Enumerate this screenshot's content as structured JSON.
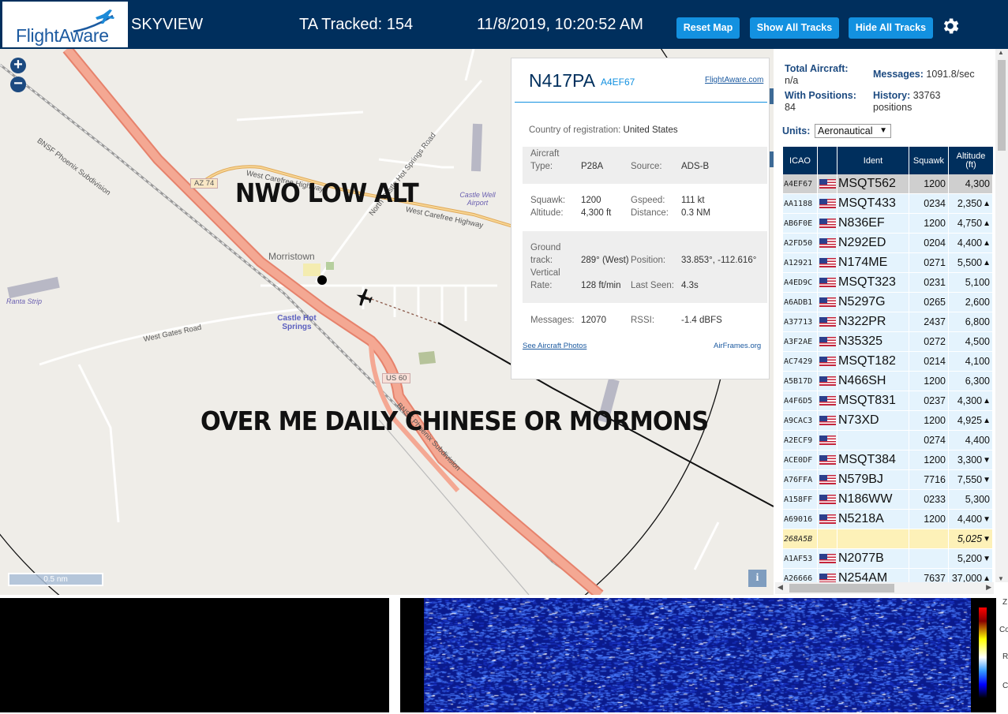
{
  "header": {
    "logo_text": "FlightAware",
    "app_name": "SKYVIEW",
    "tracked": "TA Tracked: 154",
    "datetime": "11/8/2019, 10:20:52 AM",
    "buttons": {
      "reset": "Reset Map",
      "show": "Show All Tracks",
      "hide": "Hide All Tracks"
    },
    "gear_icon": "gear-icon"
  },
  "map": {
    "zoom_in": "+",
    "zoom_out": "−",
    "labels": {
      "bnsf1": "BNSF Phoenix Subdivision",
      "bnsf2": "BNSF Phoenix Subdivision",
      "az74": "AZ 74",
      "carefree1": "West Carefree Highway",
      "carefree2": "West Carefree Highway",
      "castle_hot_springs_rd": "North Castle Hot Springs Road",
      "castle_well": "Castle Well Airport",
      "morristown": "Morristown",
      "ranta": "Ranta Strip",
      "gates": "West Gates Road",
      "castle_hot_springs": "Castle Hot Springs",
      "us60": "US 60"
    },
    "scale": "0.5 nm",
    "info": "i",
    "overlay_1": "NWO LOW ALT",
    "overlay_2": "OVER ME DAILY CHINESE OR MORMONS"
  },
  "popup": {
    "callsign": "N417PA",
    "hex": "A4EF67",
    "fa_link": "FlightAware.com",
    "country_label": "Country of registration:",
    "country": "United States",
    "aircraft_type_label_1": "Aircraft",
    "aircraft_type_label_2": "Type:",
    "aircraft_type": "P28A",
    "source_label": "Source:",
    "source": "ADS-B",
    "squawk_label": "Squawk:",
    "squawk": "1200",
    "gspeed_label": "Gspeed:",
    "gspeed": "111 kt",
    "altitude_label": "Altitude:",
    "altitude": "4,300 ft",
    "distance_label": "Distance:",
    "distance": "0.3 NM",
    "ground_label_1": "Ground",
    "ground_label_2": "track:",
    "ground_track": "289° (West)",
    "position_label": "Position:",
    "position": "33.853°, -112.616°",
    "vertical_label_1": "Vertical",
    "vertical_label_2": "Rate:",
    "vertical_rate": "128 ft/min",
    "last_seen_label": "Last Seen:",
    "last_seen": "4.3s",
    "messages_label": "Messages:",
    "messages": "12070",
    "rssi_label": "RSSI:",
    "rssi": "-1.4 dBFS",
    "photos_link": "See Aircraft Photos",
    "airframes_link": "AirFrames.org"
  },
  "panel": {
    "total_label": "Total Aircraft:",
    "total_value": "n/a",
    "messages_label": "Messages:",
    "messages_value": "1091.8/sec",
    "positions_label": "With Positions:",
    "positions_value": "84",
    "history_label": "History:",
    "history_value": "33763",
    "history_unit": "positions",
    "units_label": "Units:",
    "units_value": "Aeronautical",
    "columns": {
      "icao": "ICAO",
      "ident": "Ident",
      "squawk": "Squawk",
      "alt_1": "Altitude",
      "alt_2": "(ft)"
    },
    "rows": [
      {
        "icao": "A4EF67",
        "flag": true,
        "ident": "MSQT562",
        "squawk": "1200",
        "alt": "4,300",
        "trend": ""
      },
      {
        "icao": "AA1188",
        "flag": true,
        "ident": "MSQT433",
        "squawk": "0234",
        "alt": "2,350",
        "trend": "▲"
      },
      {
        "icao": "AB6F0E",
        "flag": true,
        "ident": "N836EF",
        "squawk": "1200",
        "alt": "4,750",
        "trend": "▲"
      },
      {
        "icao": "A2FD50",
        "flag": true,
        "ident": "N292ED",
        "squawk": "0204",
        "alt": "4,400",
        "trend": "▲"
      },
      {
        "icao": "A12921",
        "flag": true,
        "ident": "N174ME",
        "squawk": "0271",
        "alt": "5,500",
        "trend": "▲"
      },
      {
        "icao": "A4ED9C",
        "flag": true,
        "ident": "MSQT323",
        "squawk": "0231",
        "alt": "5,100",
        "trend": ""
      },
      {
        "icao": "A6ADB1",
        "flag": true,
        "ident": "N5297G",
        "squawk": "0265",
        "alt": "2,600",
        "trend": ""
      },
      {
        "icao": "A37713",
        "flag": true,
        "ident": "N322PR",
        "squawk": "2437",
        "alt": "6,800",
        "trend": ""
      },
      {
        "icao": "A3F2AE",
        "flag": true,
        "ident": "N35325",
        "squawk": "0272",
        "alt": "4,500",
        "trend": ""
      },
      {
        "icao": "AC7429",
        "flag": true,
        "ident": "MSQT182",
        "squawk": "0214",
        "alt": "4,100",
        "trend": ""
      },
      {
        "icao": "A5B17D",
        "flag": true,
        "ident": "N466SH",
        "squawk": "1200",
        "alt": "6,300",
        "trend": ""
      },
      {
        "icao": "A4F6D5",
        "flag": true,
        "ident": "MSQT831",
        "squawk": "0237",
        "alt": "4,300",
        "trend": "▲"
      },
      {
        "icao": "A9CAC3",
        "flag": true,
        "ident": "N73XD",
        "squawk": "1200",
        "alt": "4,925",
        "trend": "▲"
      },
      {
        "icao": "A2ECF9",
        "flag": true,
        "ident": "",
        "squawk": "0274",
        "alt": "4,400",
        "trend": ""
      },
      {
        "icao": "ACE0DF",
        "flag": true,
        "ident": "MSQT384",
        "squawk": "1200",
        "alt": "3,300",
        "trend": "▼"
      },
      {
        "icao": "A76FFA",
        "flag": true,
        "ident": "N579BJ",
        "squawk": "7716",
        "alt": "7,550",
        "trend": "▼"
      },
      {
        "icao": "A158FF",
        "flag": true,
        "ident": "N186WW",
        "squawk": "0233",
        "alt": "5,300",
        "trend": ""
      },
      {
        "icao": "A69016",
        "flag": true,
        "ident": "N5218A",
        "squawk": "1200",
        "alt": "4,400",
        "trend": "▼"
      },
      {
        "icao": "268A5B",
        "flag": false,
        "ident": "",
        "squawk": "",
        "alt": "5,025",
        "trend": "▼"
      },
      {
        "icao": "A1AF53",
        "flag": true,
        "ident": "N2077B",
        "squawk": "",
        "alt": "5,200",
        "trend": "▼"
      },
      {
        "icao": "A26666",
        "flag": true,
        "ident": "N254AM",
        "squawk": "7637",
        "alt": "37,000",
        "trend": "▲"
      }
    ]
  },
  "bottom": {
    "edge_glyphs": [
      "Z",
      "Co",
      "R",
      "C"
    ]
  },
  "colors": {
    "header_bg": "#002f5d",
    "button_blue": "#1391e0",
    "row_blue": "#e4f3fd",
    "row_selected": "#d9d9d9",
    "row_highlight": "#fdf1b8",
    "road_salmon": "#f0a08c"
  }
}
